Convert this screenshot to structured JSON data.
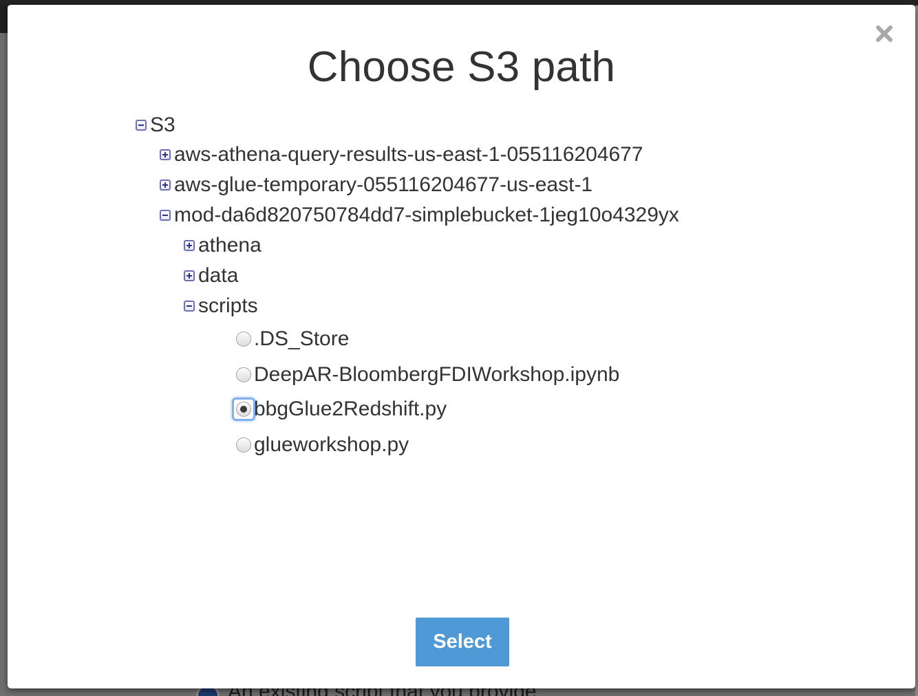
{
  "modal": {
    "title": "Choose S3 path",
    "close_symbol": "close-icon",
    "select_label": "Select"
  },
  "tree": {
    "root": {
      "label": "S3",
      "expanded": true
    },
    "buckets": [
      {
        "label": "aws-athena-query-results-us-east-1-055116204677",
        "expanded": false
      },
      {
        "label": "aws-glue-temporary-055116204677-us-east-1",
        "expanded": false
      },
      {
        "label": "mod-da6d820750784dd7-simplebucket-1jeg10o4329yx",
        "expanded": true
      }
    ],
    "folders": [
      {
        "label": "athena",
        "expanded": false
      },
      {
        "label": "data",
        "expanded": false
      },
      {
        "label": "scripts",
        "expanded": true
      }
    ],
    "files": [
      {
        "label": ".DS_Store",
        "selected": false
      },
      {
        "label": "DeepAR-BloombergFDIWorkshop.ipynb",
        "selected": false
      },
      {
        "label": "bbgGlue2Redshift.py",
        "selected": true
      },
      {
        "label": "glueworkshop.py",
        "selected": false
      }
    ]
  },
  "background": {
    "peek_text": "An existing script that you provide"
  },
  "colors": {
    "button": "#4f9ad6",
    "toggle_border": "#6a6fb8",
    "focus_ring": "#7fb0ef"
  }
}
